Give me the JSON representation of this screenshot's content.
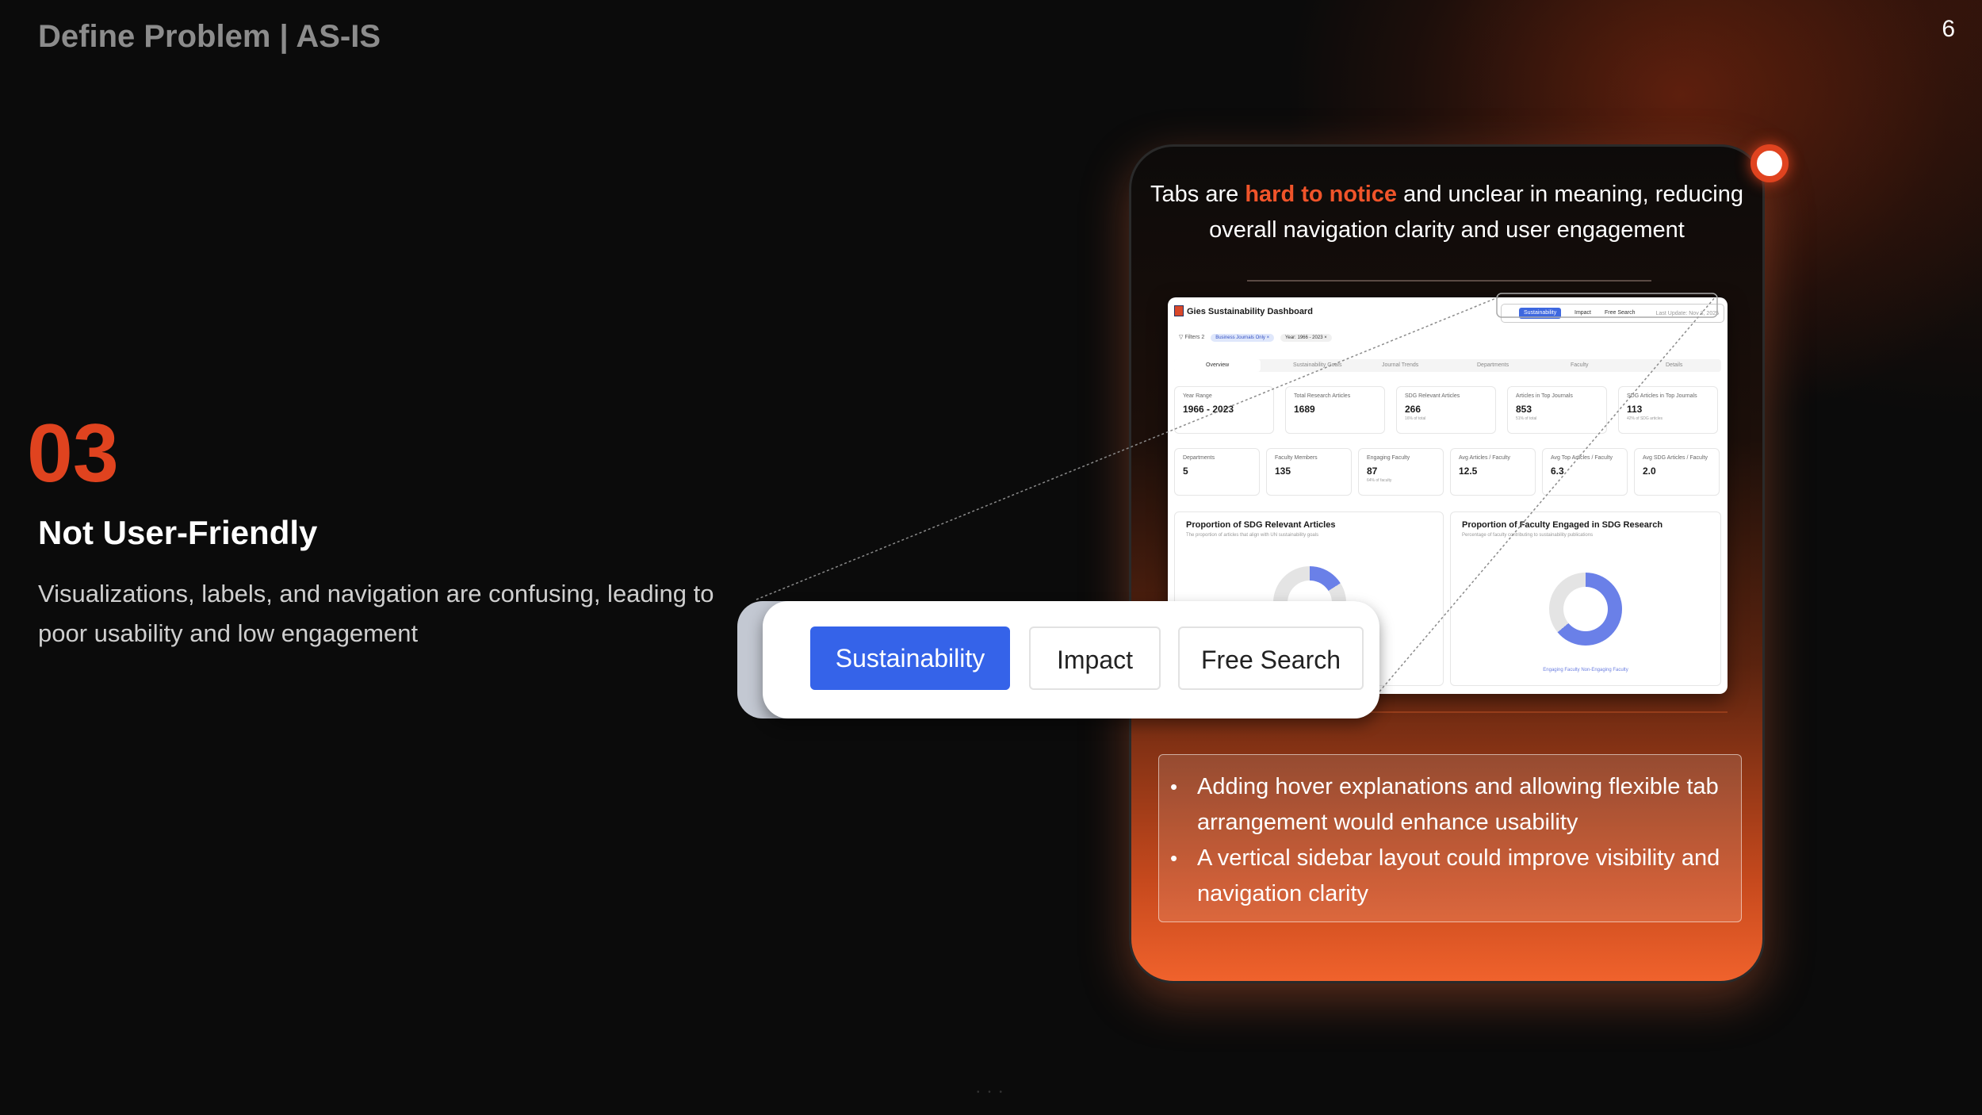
{
  "header": {
    "title": "Define Problem | AS-IS",
    "page_number": "6"
  },
  "section": {
    "number": "03",
    "title": "Not User-Friendly",
    "description": "Visualizations, labels, and navigation are confusing, leading to poor usability and low engagement"
  },
  "card": {
    "headline_pre": "Tabs are ",
    "headline_highlight": "hard to notice",
    "headline_post": " and unclear in meaning, reducing overall navigation clarity and user engagement",
    "notes": [
      "Adding hover explanations and allowing flexible tab arrangement would enhance usability",
      "A vertical sidebar layout could improve visibility and navigation clarity"
    ]
  },
  "dashboard": {
    "title": "Gies Sustainability Dashboard",
    "tabs": [
      "Sustainability",
      "Impact",
      "Free Search"
    ],
    "last_update": "Last Update: Nov 3, 2025",
    "filters_label": "Filters",
    "filters_count": "2",
    "chips": [
      "Business Journals Only ×",
      "Year: 1966 - 2023 ×"
    ],
    "subtabs": [
      "Overview",
      "Sustainability Goals",
      "Journal Trends",
      "Departments",
      "Faculty",
      "Details"
    ],
    "stats_row1": [
      {
        "label": "Year Range",
        "value": "1966 - 2023",
        "sub": ""
      },
      {
        "label": "Total Research Articles",
        "value": "1689",
        "sub": ""
      },
      {
        "label": "SDG Relevant Articles",
        "value": "266",
        "sub": "16% of total"
      },
      {
        "label": "Articles in Top Journals",
        "value": "853",
        "sub": "51% of total"
      },
      {
        "label": "SDG Articles in Top Journals",
        "value": "113",
        "sub": "42% of SDG articles"
      }
    ],
    "stats_row2": [
      {
        "label": "Departments",
        "value": "5",
        "sub": ""
      },
      {
        "label": "Faculty Members",
        "value": "135",
        "sub": ""
      },
      {
        "label": "Engaging Faculty",
        "value": "87",
        "sub": "64% of faculty"
      },
      {
        "label": "Avg Articles / Faculty",
        "value": "12.5",
        "sub": ""
      },
      {
        "label": "Avg Top Articles / Faculty",
        "value": "6.3",
        "sub": ""
      },
      {
        "label": "Avg SDG Articles / Faculty",
        "value": "2.0",
        "sub": ""
      }
    ],
    "panel_left": {
      "title": "Proportion of SDG Relevant Articles",
      "subtitle": "The proportion of articles that align with UN sustainability goals"
    },
    "panel_right": {
      "title": "Proportion of Faculty Engaged in SDG Research",
      "subtitle": "Percentage of faculty contributing to sustainability publications",
      "legend": "Engaging Faculty   Non-Engaging Faculty",
      "engaged_share": 0.64
    }
  },
  "zoom_tabs": [
    "Sustainability",
    "Impact",
    "Free Search"
  ],
  "colors": {
    "accent": "#e0431f",
    "tab_active": "#3563e9"
  }
}
